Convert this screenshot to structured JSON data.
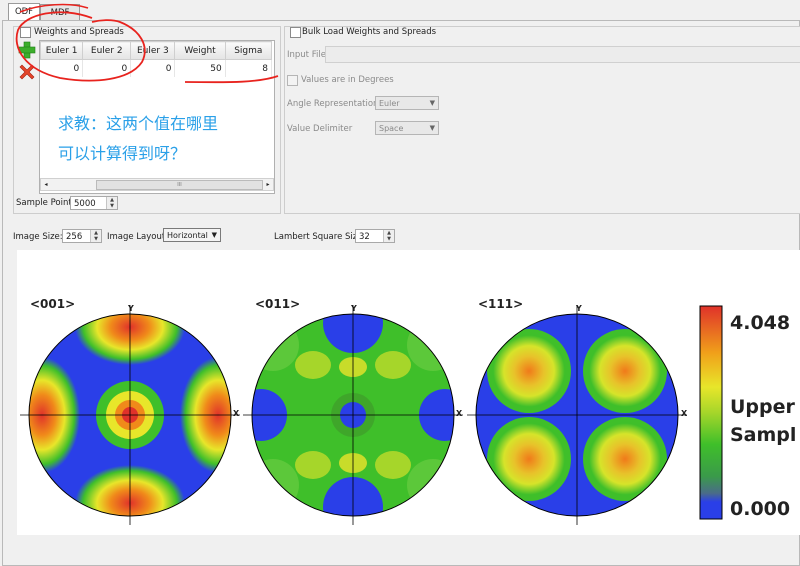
{
  "tabs": [
    {
      "label": "ODF"
    },
    {
      "label": "MDF"
    }
  ],
  "weights": {
    "group_label": "Weights and Spreads",
    "columns": [
      "Euler 1",
      "Euler 2",
      "Euler 3",
      "Weight",
      "Sigma"
    ],
    "rows": [
      [
        "0",
        "0",
        "0",
        "50",
        "8"
      ]
    ],
    "scroll_marker": "III"
  },
  "note": {
    "line1": "求教：这两个值在哪里",
    "line2": "可以计算得到呀？"
  },
  "sample_points": {
    "label": "Sample Points",
    "value": "5000"
  },
  "bulk": {
    "label": "Bulk Load Weights and Spreads",
    "input_file_label": "Input File:",
    "degrees_label": "Values are in Degrees",
    "angle_label": "Angle Representation",
    "angle_value": "Euler",
    "delim_label": "Value Delimiter",
    "delim_value": "Space"
  },
  "image_settings": {
    "size_label": "Image Size:",
    "size_value": "256",
    "layout_label": "Image Layout",
    "layout_value": "Horizontal",
    "lambert_label": "Lambert Square Size",
    "lambert_value": "32"
  },
  "pole_figures": [
    {
      "title": "<001>",
      "x_label": "X",
      "y_label": "Y"
    },
    {
      "title": "<011>",
      "x_label": "X",
      "y_label": "Y"
    },
    {
      "title": "<111>",
      "x_label": "X",
      "y_label": "Y"
    }
  ],
  "colorbar": {
    "max": "4.048",
    "min": "0.000",
    "label1": "Upper",
    "label2": "Sampl"
  },
  "colors": {
    "accent_red": "#e8231e",
    "blue": "#2a3fe8",
    "green": "#3fbf2a",
    "yellow": "#e8e62a",
    "orange": "#f07a1a",
    "red": "#e0322a"
  }
}
